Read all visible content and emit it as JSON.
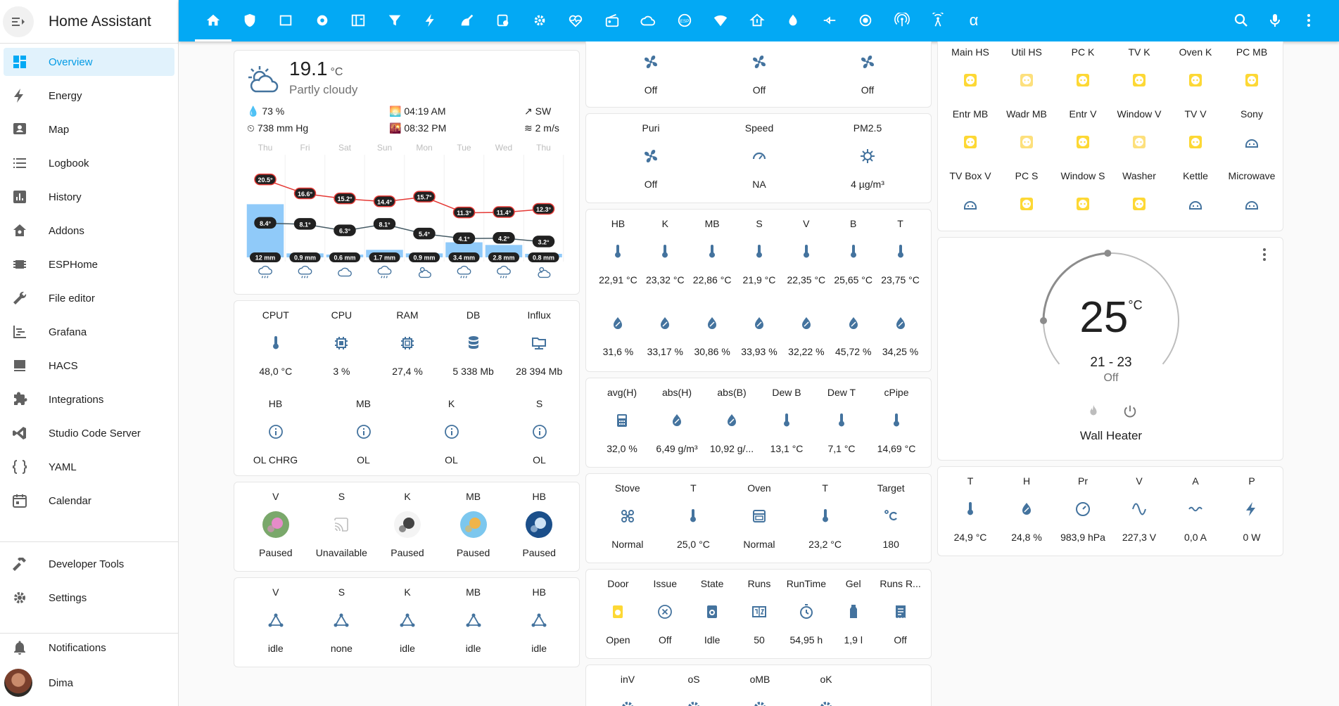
{
  "app": {
    "title": "Home Assistant"
  },
  "sidebar": {
    "items": [
      {
        "label": "Overview",
        "icon": "dashboard-icon",
        "selected": true
      },
      {
        "label": "Energy",
        "icon": "lightning-bolt-icon"
      },
      {
        "label": "Map",
        "icon": "map-account-icon"
      },
      {
        "label": "Logbook",
        "icon": "logbook-list-icon"
      },
      {
        "label": "History",
        "icon": "chart-box-icon"
      },
      {
        "label": "Addons",
        "icon": "puzzle-home-icon"
      },
      {
        "label": "ESPHome",
        "icon": "chip-icon"
      },
      {
        "label": "File editor",
        "icon": "wrench-icon"
      },
      {
        "label": "Grafana",
        "icon": "chart-timeline-icon"
      },
      {
        "label": "HACS",
        "icon": "hacs-icon"
      },
      {
        "label": "Integrations",
        "icon": "puzzle-icon"
      },
      {
        "label": "Studio Code Server",
        "icon": "vscode-icon"
      },
      {
        "label": "YAML",
        "icon": "code-braces-icon"
      },
      {
        "label": "Calendar",
        "icon": "calendar-icon"
      }
    ],
    "bottom": [
      {
        "label": "Developer Tools",
        "icon": "hammer-icon"
      },
      {
        "label": "Settings",
        "icon": "cog-icon"
      }
    ],
    "notifications": "Notifications",
    "user": "Dima"
  },
  "topbar": {
    "alpha": "α",
    "tabs": [
      "home-icon",
      "shield-icon",
      "rectangle-icon",
      "record-icon",
      "panel-icon",
      "filter-icon",
      "flash-icon",
      "robot-vacuum-icon",
      "tasks-icon",
      "settings-cog-icon",
      "heart-pulse-icon",
      "radio-icon",
      "cloud-icon",
      "esp-icon",
      "wifi-cog-icon",
      "home-thermometer-icon",
      "water-icon",
      "valve-icon",
      "circle-dot-icon",
      "antenna-icon",
      "wifi-tower-icon"
    ]
  },
  "weather": {
    "temp": "19.1",
    "unit": "°C",
    "condition": "Partly cloudy",
    "humidity": "73 %",
    "pressure": "738 mm Hg",
    "sunrise": "04:19 AM",
    "sunset": "08:32 PM",
    "wind_dir": "SW",
    "wind_speed": "2 m/s",
    "days": [
      "Thu",
      "Fri",
      "Sat",
      "Sun",
      "Mon",
      "Tue",
      "Wed",
      "Thu"
    ],
    "highs": [
      "20.5°",
      "16.6°",
      "15.2°",
      "14.4°",
      "15.7°",
      "11.3°",
      "11.4°",
      "12.3°"
    ],
    "lows": [
      "8.4°",
      "8.1°",
      "6.3°",
      "8.1°",
      "5.4°",
      "4.1°",
      "4.2°",
      "3.2°"
    ],
    "precip": [
      "12 mm",
      "0.9 mm",
      "0.6 mm",
      "1.7 mm",
      "0.9 mm",
      "3.4 mm",
      "2.8 mm",
      "0.8 mm"
    ]
  },
  "system": {
    "row1": [
      {
        "name": "CPUT",
        "state": "48,0 °C"
      },
      {
        "name": "CPU",
        "state": "3 %"
      },
      {
        "name": "RAM",
        "state": "27,4 %"
      },
      {
        "name": "DB",
        "state": "5 338 Mb"
      },
      {
        "name": "Influx",
        "state": "28 394 Mb"
      }
    ],
    "row2": [
      {
        "name": "HB",
        "state": "OL CHRG"
      },
      {
        "name": "MB",
        "state": "OL"
      },
      {
        "name": "K",
        "state": "OL"
      },
      {
        "name": "S",
        "state": "OL"
      }
    ]
  },
  "media": [
    {
      "name": "V",
      "state": "Paused"
    },
    {
      "name": "S",
      "state": "Unavailable"
    },
    {
      "name": "K",
      "state": "Paused"
    },
    {
      "name": "MB",
      "state": "Paused"
    },
    {
      "name": "HB",
      "state": "Paused"
    }
  ],
  "network": [
    {
      "name": "V",
      "state": "idle"
    },
    {
      "name": "S",
      "state": "none"
    },
    {
      "name": "K",
      "state": "idle"
    },
    {
      "name": "MB",
      "state": "idle"
    },
    {
      "name": "HB",
      "state": "idle"
    }
  ],
  "fans_top": [
    "Off",
    "Off",
    "Off"
  ],
  "purifier": [
    {
      "name": "Puri",
      "state": "Off"
    },
    {
      "name": "Speed",
      "state": "NA"
    },
    {
      "name": "PM2.5",
      "state": "4 µg/m³"
    }
  ],
  "climate": {
    "names": [
      "HB",
      "K",
      "MB",
      "S",
      "V",
      "B",
      "T"
    ],
    "temps": [
      "22,91 °C",
      "23,32 °C",
      "22,86 °C",
      "21,9 °C",
      "22,35 °C",
      "25,65 °C",
      "23,75 °C"
    ],
    "hums": [
      "31,6 %",
      "33,17 %",
      "30,86 %",
      "33,93 %",
      "32,22 %",
      "45,72 %",
      "34,25 %"
    ]
  },
  "calc": [
    {
      "name": "avg(H)",
      "state": "32,0 %"
    },
    {
      "name": "abs(H)",
      "state": "6,49 g/m³"
    },
    {
      "name": "abs(B)",
      "state": "10,92 g/..."
    },
    {
      "name": "Dew B",
      "state": "13,1 °C"
    },
    {
      "name": "Dew T",
      "state": "7,1 °C"
    },
    {
      "name": "cPipe",
      "state": "14,69 °C"
    }
  ],
  "kitchen": [
    {
      "name": "Stove",
      "state": "Normal"
    },
    {
      "name": "T",
      "state": "25,0 °C"
    },
    {
      "name": "Oven",
      "state": "Normal"
    },
    {
      "name": "T",
      "state": "23,2 °C"
    },
    {
      "name": "Target",
      "state": "180"
    }
  ],
  "washer": [
    {
      "name": "Door",
      "state": "Open"
    },
    {
      "name": "Issue",
      "state": "Off"
    },
    {
      "name": "State",
      "state": "Idle"
    },
    {
      "name": "Runs",
      "state": "50"
    },
    {
      "name": "RunTime",
      "state": "54,95 h"
    },
    {
      "name": "Gel",
      "state": "1,9 l"
    },
    {
      "name": "Runs R...",
      "state": "Off"
    }
  ],
  "extra": [
    "inV",
    "oS",
    "oMB",
    "oK"
  ],
  "plugs": [
    [
      "Main HS",
      "Util HS",
      "PC K",
      "TV K",
      "Oven K",
      "PC MB"
    ],
    [
      "Entr MB",
      "Wadr MB",
      "Entr V",
      "Window V",
      "TV V",
      "Sony"
    ],
    [
      "TV Box V",
      "PC S",
      "Window S",
      "Washer",
      "Kettle",
      "Microwave"
    ]
  ],
  "plug_states": [
    [
      "on",
      "dim",
      "on",
      "on",
      "on",
      "on"
    ],
    [
      "on",
      "dim",
      "on",
      "dim",
      "on",
      "off"
    ],
    [
      "off",
      "on",
      "on",
      "on",
      "off",
      "off"
    ]
  ],
  "thermostat": {
    "temp": "25",
    "unit": "°C",
    "range": "21 - 23",
    "mode": "Off",
    "name": "Wall Heater",
    "level": 0.72
  },
  "power": [
    {
      "name": "T",
      "state": "24,9 °C"
    },
    {
      "name": "H",
      "state": "24,8 %"
    },
    {
      "name": "Pr",
      "state": "983,9 hPa"
    },
    {
      "name": "V",
      "state": "227,3 V"
    },
    {
      "name": "A",
      "state": "0,0 A"
    },
    {
      "name": "P",
      "state": "0 W"
    }
  ],
  "colors": {
    "accent": "#03a9f4",
    "icon": "#44739e",
    "plug_on": "#fdd835",
    "plug_dim": "#fde07c",
    "high": "#e53935",
    "low": "#455a64",
    "precip": "#90caf9"
  }
}
